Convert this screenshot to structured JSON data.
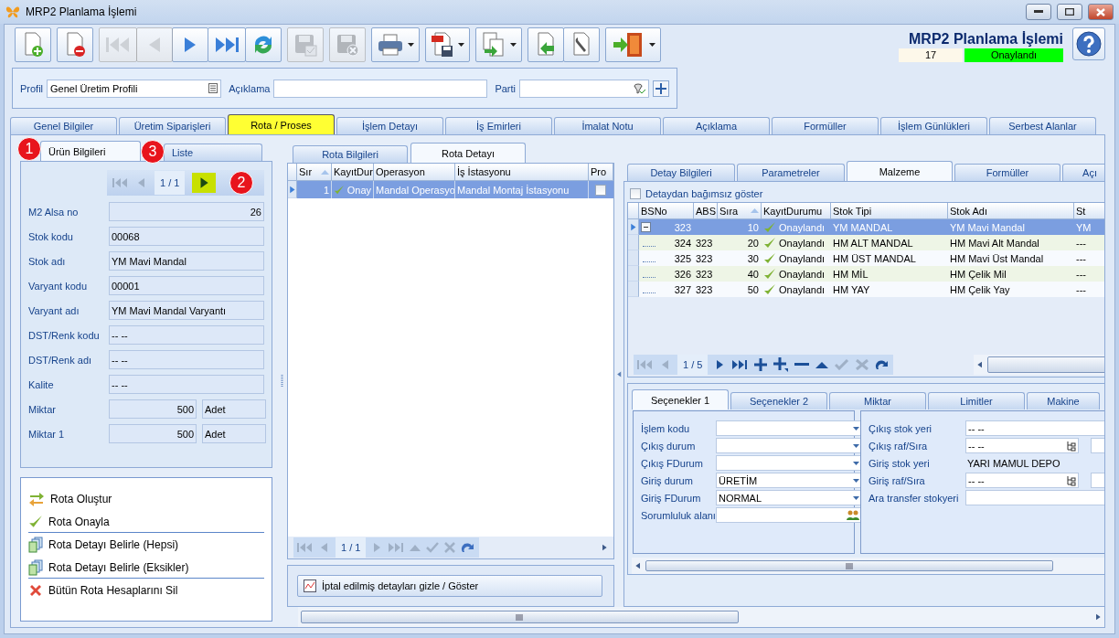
{
  "window": {
    "title": "MRP2 Planlama İşlemi"
  },
  "toolbar": [
    [
      {
        "kind": "new",
        "disabled": false,
        "dropdown": false
      }
    ],
    [
      {
        "kind": "delete",
        "disabled": false,
        "dropdown": false
      }
    ],
    [
      {
        "kind": "first",
        "disabled": true,
        "dropdown": false
      },
      {
        "kind": "prev",
        "disabled": true,
        "dropdown": false
      },
      {
        "kind": "next",
        "disabled": false,
        "dropdown": false
      },
      {
        "kind": "last",
        "disabled": false,
        "dropdown": false
      },
      {
        "kind": "refresh",
        "disabled": false,
        "dropdown": false
      }
    ],
    [
      {
        "kind": "save",
        "disabled": true,
        "dropdown": false
      }
    ],
    [
      {
        "kind": "discard",
        "disabled": true,
        "dropdown": false
      }
    ],
    [
      {
        "kind": "print",
        "disabled": false,
        "dropdown": true
      }
    ],
    [
      {
        "kind": "pdf",
        "disabled": false,
        "dropdown": true
      }
    ],
    [
      {
        "kind": "export",
        "disabled": false,
        "dropdown": true
      }
    ],
    [
      {
        "kind": "import",
        "disabled": false,
        "dropdown": false
      },
      {
        "kind": "tools",
        "disabled": false,
        "dropdown": false
      }
    ],
    [
      {
        "kind": "exit",
        "disabled": false,
        "dropdown": true
      }
    ]
  ],
  "header": {
    "title": "MRP2 Planlama İşlemi",
    "number": "17",
    "status": "Onaylandı"
  },
  "filter": {
    "profile_label": "Profil",
    "profile": "Genel Üretim Profili",
    "description_label": "Açıklama",
    "party_label": "Parti"
  },
  "main_tabs": [
    {
      "label": "Genel Bilgiler",
      "selected": false
    },
    {
      "label": "Üretim Siparişleri",
      "selected": false
    },
    {
      "label": "Rota / Proses",
      "selected": true
    },
    {
      "label": "İşlem Detayı",
      "selected": false
    },
    {
      "label": "İş Emirleri",
      "selected": false
    },
    {
      "label": "İmalat Notu",
      "selected": false
    },
    {
      "label": "Açıklama",
      "selected": false
    },
    {
      "label": "Formüller",
      "selected": false
    },
    {
      "label": "İşlem Günlükleri",
      "selected": false
    },
    {
      "label": "Serbest Alanlar",
      "selected": false
    }
  ],
  "left": {
    "tabs": [
      {
        "label": "Ürün Bilgileri",
        "selected": true,
        "badge": "1"
      },
      {
        "label": "Liste",
        "selected": false,
        "badge": "3"
      }
    ],
    "navigator": {
      "position": "1 / 1",
      "next_badge": "2"
    },
    "fields": [
      {
        "label": "M2 Alsa no",
        "value": "26",
        "kind": "number"
      },
      {
        "label": "Stok kodu",
        "value": "00068",
        "kind": "text"
      },
      {
        "label": "Stok adı",
        "value": "YM Mavi Mandal",
        "kind": "text"
      },
      {
        "label": "Varyant kodu",
        "value": "00001",
        "kind": "text"
      },
      {
        "label": "Varyant adı",
        "value": "YM Mavi Mandal Varyantı",
        "kind": "text"
      },
      {
        "label": "DST/Renk kodu",
        "value": "-- --",
        "kind": "text"
      },
      {
        "label": "DST/Renk adı",
        "value": "-- --",
        "kind": "text"
      },
      {
        "label": "Kalite",
        "value": "-- --",
        "kind": "text"
      },
      {
        "label": "Miktar",
        "value": "500",
        "unit": "Adet",
        "kind": "quantity"
      },
      {
        "label": "Miktar 1",
        "value": "500",
        "unit": "Adet",
        "kind": "quantity"
      }
    ],
    "actions": [
      {
        "label": "Rota Oluştur",
        "kind": "create",
        "separator_after": false
      },
      {
        "label": "Rota Onayla",
        "kind": "approve",
        "separator_after": true
      },
      {
        "label": "Rota Detayı Belirle (Hepsi)",
        "kind": "detail",
        "separator_after": false
      },
      {
        "label": "Rota Detayı Belirle (Eksikler)",
        "kind": "detail",
        "separator_after": true
      },
      {
        "label": "Bütün Rota Hesaplarını Sil",
        "kind": "delete",
        "separator_after": false
      }
    ]
  },
  "route_tabs": [
    {
      "label": "Rota Bilgileri",
      "selected": false
    },
    {
      "label": "Rota Detayı",
      "selected": true
    }
  ],
  "route_grid": {
    "columns": [
      "Sır",
      "KayıtDur",
      "Operasyon",
      "İş İstasyonu",
      "Pro"
    ],
    "rows": [
      {
        "sira": "1",
        "approved": true,
        "status": "Onay",
        "operation": "Mandal Operasyo",
        "station": "Mandal Montaj İstasyonu",
        "pro": false,
        "selected": true
      }
    ],
    "navigator": "1 / 1"
  },
  "cancel_toggle": "İptal edilmiş detayları gizle / Göster",
  "detail_tabs": [
    {
      "label": "Detay Bilgileri",
      "selected": false
    },
    {
      "label": "Parametreler",
      "selected": false
    },
    {
      "label": "Malzeme",
      "selected": true
    },
    {
      "label": "Formüller",
      "selected": false
    },
    {
      "label": "Açı",
      "selected": false
    }
  ],
  "independent": {
    "label": "Detaydan bağımsız göster",
    "checked": false
  },
  "material_grid": {
    "columns": [
      "BSNo",
      "ABS",
      "Sıra",
      "KayıtDurumu",
      "Stok Tipi",
      "Stok Adı",
      "St"
    ],
    "rows": [
      {
        "bsno": "323",
        "sira": "10",
        "approved": true,
        "status": "Onaylandı",
        "stock_type": "YM MANDAL",
        "stock_name": "YM Mavi Mandal",
        "column_7": "YM",
        "selected": true,
        "expanded": true,
        "children": [
          {
            "bsno": "324",
            "absno": "323",
            "sira": "20",
            "approved": true,
            "status": "Onaylandı",
            "stock_type": "HM ALT MANDAL",
            "stock_name": "HM Mavi Alt Mandal",
            "column_7": "---",
            "selected": false
          },
          {
            "bsno": "325",
            "absno": "323",
            "sira": "30",
            "approved": true,
            "status": "Onaylandı",
            "stock_type": "HM ÜST MANDAL",
            "stock_name": "HM Mavi Üst Mandal",
            "column_7": "---",
            "selected": false
          },
          {
            "bsno": "326",
            "absno": "323",
            "sira": "40",
            "approved": true,
            "status": "Onaylandı",
            "stock_type": "HM MİL",
            "stock_name": "HM Çelik Mil",
            "column_7": "---",
            "selected": false
          },
          {
            "bsno": "327",
            "absno": "323",
            "sira": "50",
            "approved": true,
            "status": "Onaylandı",
            "stock_type": "HM YAY",
            "stock_name": "HM Çelik Yay",
            "column_7": "---",
            "selected": false
          }
        ]
      }
    ],
    "navigator": "1 / 5"
  },
  "option_tabs": [
    {
      "label": "Seçenekler 1",
      "selected": true
    },
    {
      "label": "Seçenekler 2",
      "selected": false
    },
    {
      "label": "Miktar",
      "selected": false
    },
    {
      "label": "Limitler",
      "selected": false
    },
    {
      "label": "Makine",
      "selected": false
    }
  ],
  "options_left": [
    {
      "label": "İşlem kodu",
      "kind": "dropdown"
    },
    {
      "label": "Çıkış durum",
      "kind": "dropdown"
    },
    {
      "label": "Çıkış FDurum",
      "kind": "dropdown"
    },
    {
      "label": "Giriş durum",
      "value": "ÜRETİM",
      "kind": "dropdown"
    },
    {
      "label": "Giriş FDurum",
      "value": "NORMAL",
      "kind": "dropdown"
    },
    {
      "label": "Sorumluluk alanı",
      "kind": "people"
    }
  ],
  "options_right": [
    {
      "label": "Çıkış stok yeri",
      "value": "-- --",
      "kind": "text"
    },
    {
      "label": "Çıkış raf/Sıra",
      "value": "-- --",
      "kind": "tree"
    },
    {
      "label": "Giriş stok yeri",
      "value": "YARI MAMUL DEPO",
      "kind": "plain"
    },
    {
      "label": "Giriş raf/Sıra",
      "value": "-- --",
      "kind": "tree"
    },
    {
      "label": "Ara transfer stokyeri",
      "kind": "text"
    }
  ]
}
